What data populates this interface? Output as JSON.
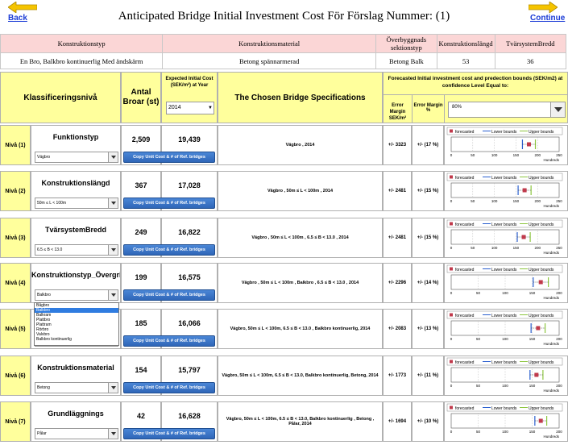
{
  "header": {
    "title": "Anticipated Bridge Initial Investment Cost För Förslag Nummer: (1)",
    "back_label": "Back",
    "continue_label": "Continue",
    "arrow_color": "#f5c400"
  },
  "summary_table": {
    "headers": [
      "Konstruktionstyp",
      "Konstruktionsmaterial",
      "Överbyggnads sektionstyp",
      "Konstruktionslängd",
      "TvärsystemBredd"
    ],
    "values": [
      "En Bro, Balkbro kontinuerlig Med ändskärm",
      "Betong spännarmerad",
      "Betong Balk",
      "53",
      "36"
    ]
  },
  "columns": {
    "klass": "Klassificeringsnivå",
    "antal": "Antal Broar (st)",
    "expected": "Expected Initial Cost (SEK/m²) at Year",
    "year": "2014",
    "chosen": "The Chosen Bridge Specifications",
    "forecast": "Forecasted Initial investment cost and predection bounds (SEK/m2) at confidence Level Equal to:",
    "error_margin": "Error Margin SEK/m²",
    "error_margin_pct": "Error Margin %",
    "confidence": "80%"
  },
  "levels": [
    {
      "niva": "Nivå (1)",
      "name": "Funktionstyp",
      "select": "Vägbro",
      "antal": "2,509",
      "cost": "19,439",
      "spec": "Vägbro , 2014",
      "em": "+/- 3323",
      "emp": "+/- (17 %)",
      "chart": {
        "forecast": 180,
        "lower": 165,
        "upper": 195,
        "axis_max": 250,
        "ticks": [
          "0",
          "50",
          "100",
          "150",
          "200",
          "250"
        ]
      }
    },
    {
      "niva": "Nivå (2)",
      "name": "Konstruktionslängd",
      "select": "50m ≤ L < 100m",
      "antal": "367",
      "cost": "17,028",
      "spec": "Vägbro ,  50m ≤ L < 100m , 2014",
      "em": "+/- 2481",
      "emp": "+/- (15 %)",
      "chart": {
        "forecast": 170,
        "lower": 155,
        "upper": 185,
        "axis_max": 250,
        "ticks": [
          "0",
          "50",
          "100",
          "150",
          "200",
          "250"
        ]
      }
    },
    {
      "niva": "Nivå (3)",
      "name": "TvärsystemBredd",
      "select": "6.5 ≤ B < 13.0",
      "antal": "249",
      "cost": "16,822",
      "spec": "Vägbro ,  50m ≤ L < 100m , 6.5 ≤ B < 13.0 , 2014",
      "em": "+/- 2481",
      "emp": "+/- (15 %)",
      "chart": {
        "forecast": 168,
        "lower": 153,
        "upper": 183,
        "axis_max": 250,
        "ticks": [
          "0",
          "50",
          "100",
          "150",
          "200",
          "250"
        ]
      }
    },
    {
      "niva": "Nivå (4)",
      "name": "Konstruktionstyp_Övergrip",
      "select": "Balkbro",
      "antal": "199",
      "cost": "16,575",
      "spec": "Vägbro ,  50m ≤ L < 100m , Balkbro , 6.5 ≤ B < 13.0 , 2014",
      "em": "+/- 2296",
      "emp": "+/- (14 %)",
      "chart": {
        "forecast": 166,
        "lower": 152,
        "upper": 180,
        "axis_max": 200,
        "ticks": [
          "0",
          "50",
          "100",
          "150",
          "200"
        ]
      }
    },
    {
      "niva": "Nivå (5)",
      "name": "",
      "select": "Balkbro kontinuerlig",
      "antal": "185",
      "cost": "16,066",
      "spec": "Vägbro, 50m ≤ L < 100m, 6.5 ≤ B < 13.0 , Balkbro kontinuerlig, 2014",
      "em": "+/- 2083",
      "emp": "+/- (13 %)",
      "chart": {
        "forecast": 161,
        "lower": 148,
        "upper": 174,
        "axis_max": 200,
        "ticks": [
          "0",
          "50",
          "100",
          "150",
          "200"
        ]
      }
    },
    {
      "niva": "Nivå (6)",
      "name": "Konstruktionsmaterial",
      "select": "Betong",
      "antal": "154",
      "cost": "15,797",
      "spec": "Vägbro, 50m ≤ L < 100m, 6.5 ≤ B < 13.0, Balkbro kontinuerlig, Betong, 2014",
      "em": "+/- 1773",
      "emp": "+/- (11 %)",
      "chart": {
        "forecast": 158,
        "lower": 146,
        "upper": 170,
        "axis_max": 200,
        "ticks": [
          "0",
          "50",
          "100",
          "150",
          "200"
        ]
      }
    },
    {
      "niva": "Nivå (7)",
      "name": "Grundläggnings",
      "select": "Pålar",
      "antal": "42",
      "cost": "16,628",
      "spec": "Vägbro, 50m ≤ L < 100m, 6.5 ≤ B < 13.0, Balkbro kontinuerlig , Betong , Pålar, 2014",
      "em": "+/- 1694",
      "emp": "+/- (10 %)",
      "chart": {
        "forecast": 166,
        "lower": 155,
        "upper": 177,
        "axis_max": 200,
        "ticks": [
          "0",
          "50",
          "100",
          "150",
          "200"
        ]
      }
    }
  ],
  "chart_legend": {
    "forecasted": "forecasted",
    "lower": "Lower bounds",
    "upper": "Upper bounds",
    "unit": "Hundreds"
  },
  "chart_colors": {
    "forecast": "#c0394b",
    "lower": "#2a5fcf",
    "upper": "#8dc63f"
  },
  "copy_button_label": "Copy Unit Cost & # of Ref. bridges",
  "dropdown_open": {
    "items": [
      "Bågbro",
      "Balkbro",
      "Balkram",
      "Plattbro",
      "Plattram",
      "Rörbro",
      "Valvbro",
      "Balkbro kontinuerlig"
    ],
    "highlighted": 1
  }
}
